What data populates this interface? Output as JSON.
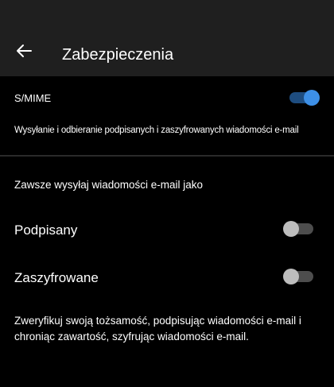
{
  "header": {
    "title": "Zabezpieczenia",
    "back_icon": "arrow-left-icon"
  },
  "smime": {
    "label": "S/MIME",
    "description": "Wysyłanie i odbieranie podpisanych i zaszyfrowanych wiadomości e-mail",
    "enabled": true
  },
  "always_send": {
    "label": "Zawsze wysyłaj wiadomości e-mail jako"
  },
  "signed": {
    "label": "Podpisany",
    "enabled": false
  },
  "encrypted": {
    "label": "Zaszyfrowane",
    "enabled": false
  },
  "footer": {
    "text": "Zweryfikuj swoją tożsamość, podpisując wiadomości e-mail i\nchroniąc zawartość, szyfrując wiadomości e-mail."
  },
  "colors": {
    "background": "#000000",
    "header": "#1f1f1f",
    "toggle_on_track": "#1e4d80",
    "toggle_on_knob": "#3d8fe6",
    "toggle_off_track": "#4d4d4d",
    "toggle_off_knob": "#bdbdbd"
  }
}
